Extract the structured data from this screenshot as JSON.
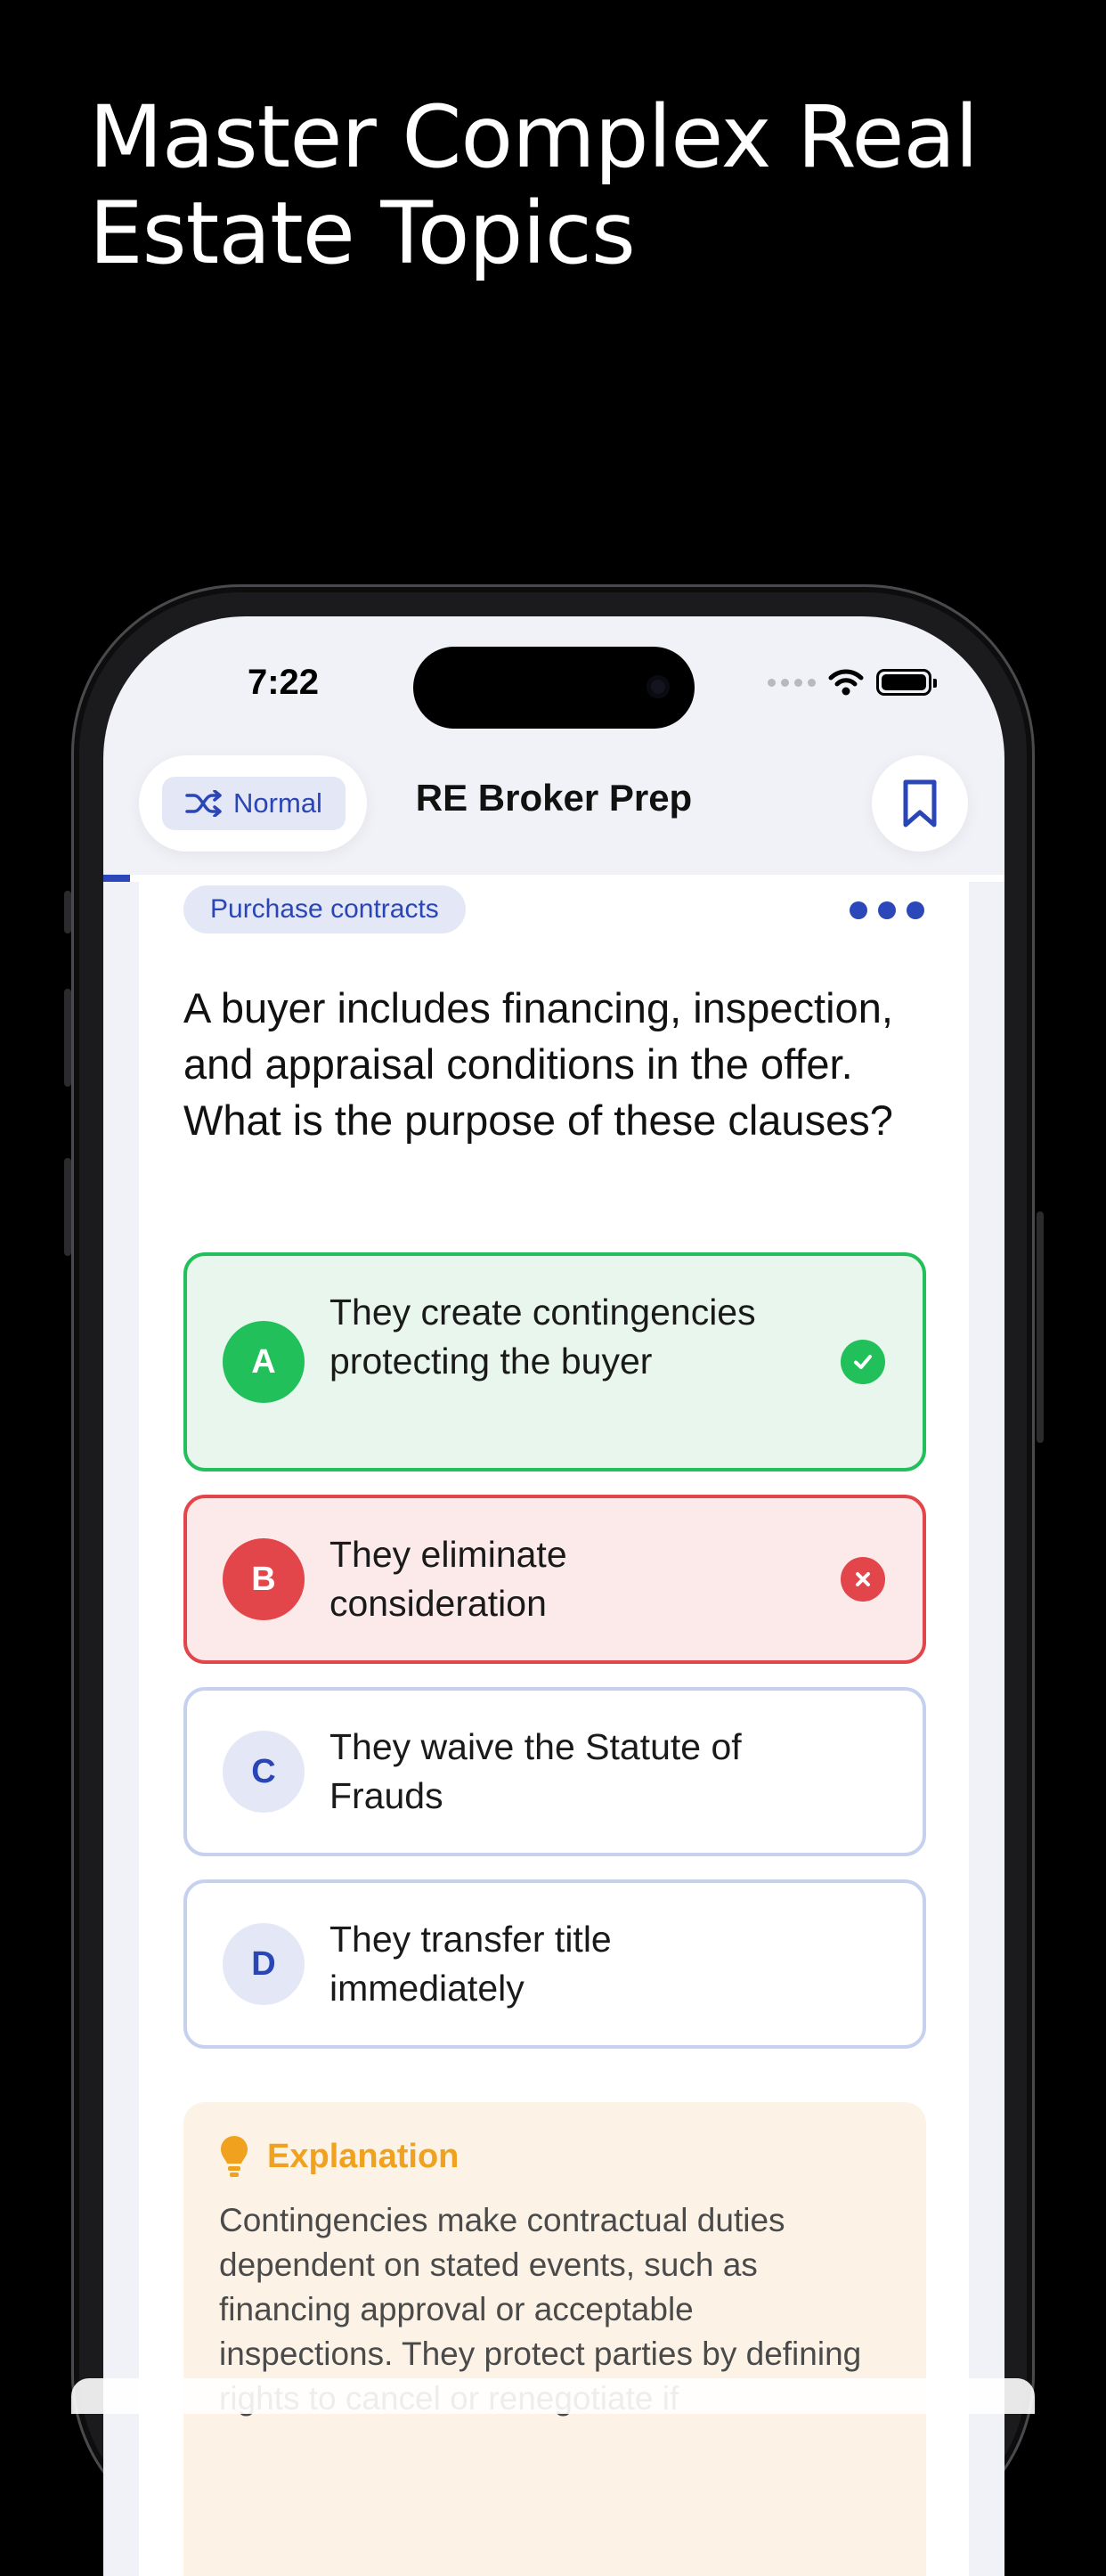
{
  "promo": {
    "headline": "Master Complex Real Estate Topics"
  },
  "status_bar": {
    "time": "7:22"
  },
  "header": {
    "mode_label": "Normal",
    "app_title": "RE Broker Prep",
    "progress_fraction": 0.03
  },
  "question_card": {
    "topic": "Purchase contracts",
    "question": "A buyer includes financing, inspection, and appraisal conditions in the offer. What is the purpose of these clauses?",
    "options": [
      {
        "letter": "A",
        "text": "They create contingencies protecting the buyer",
        "state": "correct"
      },
      {
        "letter": "B",
        "text": "They eliminate consideration",
        "state": "incorrect"
      },
      {
        "letter": "C",
        "text": "They waive the Statute of Frauds",
        "state": "neutral"
      },
      {
        "letter": "D",
        "text": "They transfer title immediately",
        "state": "neutral"
      }
    ]
  },
  "explanation": {
    "title": "Explanation",
    "body": "Contingencies make contractual duties dependent on stated events, such as financing approval or acceptable inspections. They protect parties by defining rights to cancel or renegotiate if"
  },
  "colors": {
    "accent": "#2b47b9",
    "correct": "#22c05a",
    "incorrect": "#e2454a",
    "explanation_title": "#f0a21e"
  }
}
